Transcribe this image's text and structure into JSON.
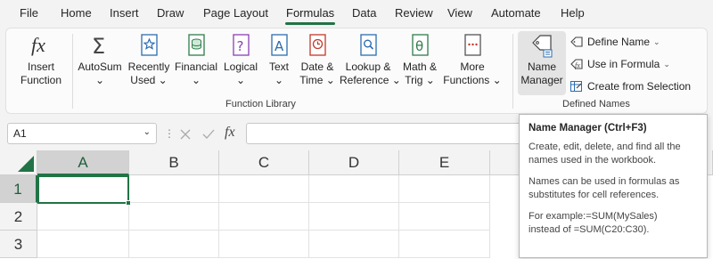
{
  "menu": {
    "tabs": [
      "File",
      "Home",
      "Insert",
      "Draw",
      "Page Layout",
      "Formulas",
      "Data",
      "Review",
      "View",
      "Automate",
      "Help"
    ],
    "active_tab": "Formulas"
  },
  "ribbon": {
    "insert_function": {
      "line1": "Insert",
      "line2": "Function"
    },
    "autosum": {
      "line1": "AutoSum",
      "line2": "⌄"
    },
    "recently_used": {
      "line1": "Recently",
      "line2": "Used ⌄"
    },
    "financial": {
      "line1": "Financial",
      "line2": "⌄"
    },
    "logical": {
      "line1": "Logical",
      "line2": "⌄"
    },
    "text": {
      "line1": "Text",
      "line2": "⌄"
    },
    "date_time": {
      "line1": "Date &",
      "line2": "Time ⌄"
    },
    "lookup_reference": {
      "line1": "Lookup &",
      "line2": "Reference ⌄"
    },
    "math_trig": {
      "line1": "Math &",
      "line2": "Trig ⌄"
    },
    "more_functions": {
      "line1": "More",
      "line2": "Functions ⌄"
    },
    "function_library_label": "Function Library",
    "name_manager": {
      "line1": "Name",
      "line2": "Manager"
    },
    "define_name": "Define Name",
    "use_in_formula": "Use in Formula",
    "create_from_selection": "Create from Selection",
    "defined_names_label": "Defined Names"
  },
  "formula_bar": {
    "name_box_value": "A1",
    "fx_symbol": "fx",
    "formula_value": ""
  },
  "grid": {
    "columns": [
      "A",
      "B",
      "C",
      "D",
      "E"
    ],
    "rows": [
      "1",
      "2",
      "3"
    ],
    "active_cell": "A1"
  },
  "tooltip": {
    "title": "Name Manager (Ctrl+F3)",
    "p1": "Create, edit, delete, and find all the names used in the workbook.",
    "p2": "Names can be used in formulas as substitutes for cell references.",
    "p3_line1": "For example:=SUM(MySales)",
    "p3_line2": "instead of =SUM(C20:C30)."
  },
  "colors": {
    "accent": "#217346"
  }
}
